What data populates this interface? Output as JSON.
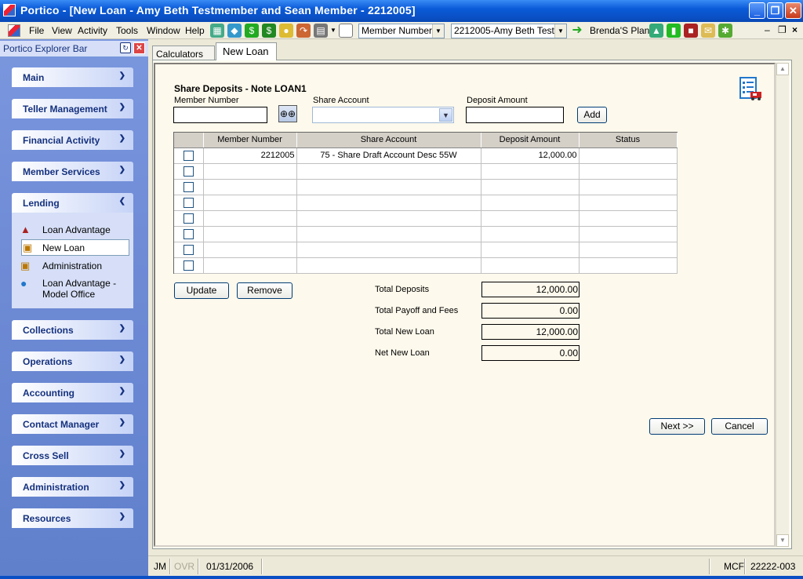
{
  "window": {
    "title": "Portico - [New Loan - Amy Beth Testmember and Sean Member - 2212005]",
    "minimize": "_",
    "restore": "❐",
    "close": "✕"
  },
  "menu": {
    "items": [
      "File",
      "View",
      "Activity",
      "Tools",
      "Window",
      "Help"
    ]
  },
  "toolbar": {
    "search_type": "Member Number",
    "member_selector": "2212005-Amy Beth Test",
    "plan_label": "Brenda'S Plan",
    "mdi_minimize": "–",
    "mdi_restore": "❐",
    "mdi_close": "×"
  },
  "explorer": {
    "title": "Portico Explorer Bar",
    "panels": {
      "main": "Main",
      "teller": "Teller Management",
      "financial": "Financial Activity",
      "member_services": "Member Services",
      "lending": "Lending",
      "collections": "Collections",
      "operations": "Operations",
      "accounting": "Accounting",
      "contact_manager": "Contact Manager",
      "cross_sell": "Cross Sell",
      "administration": "Administration",
      "resources": "Resources"
    },
    "lending_items": [
      "Loan Advantage",
      "New Loan",
      "Administration",
      "Loan Advantage - Model Office"
    ]
  },
  "tabs": [
    "Calculators",
    "New Loan"
  ],
  "form": {
    "section_title": "Share Deposits - Note LOAN1",
    "member_number_label": "Member Number",
    "member_number_value": "",
    "share_account_label": "Share Account",
    "share_account_value": "",
    "deposit_amount_label": "Deposit Amount",
    "deposit_amount_value": "",
    "add_button": "Add"
  },
  "grid": {
    "columns": [
      "",
      "Member Number",
      "Share Account",
      "Deposit Amount",
      "Status"
    ],
    "rows": [
      {
        "member_number": "2212005",
        "share_account": "75 - Share Draft Account Desc 55W",
        "deposit_amount": "12,000.00",
        "status": ""
      }
    ],
    "empty_rows": 7
  },
  "actions": {
    "update": "Update",
    "remove": "Remove",
    "next": "Next >>",
    "cancel": "Cancel"
  },
  "totals": {
    "deposits_label": "Total Deposits",
    "deposits_value": "12,000.00",
    "payoff_label": "Total Payoff and Fees",
    "payoff_value": "0.00",
    "new_loan_label": "Total New Loan",
    "new_loan_value": "12,000.00",
    "net_label": "Net New Loan",
    "net_value": "0.00"
  },
  "status": {
    "user": "JM",
    "ovr": "OVR",
    "date": "01/31/2006",
    "mcf": "MCF",
    "code": "22222-003"
  },
  "colors": {
    "title_blue": "#0a5ad8",
    "explorer_bg": "#6f8bd6",
    "panel_text": "#15317e",
    "content_bg": "#fdf9ec"
  }
}
